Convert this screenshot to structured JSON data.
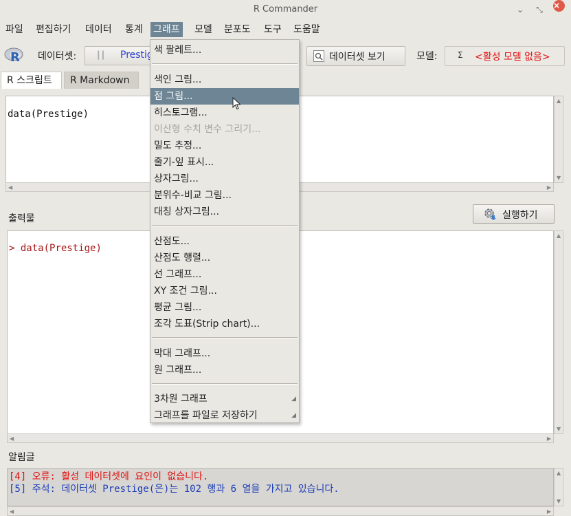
{
  "window": {
    "title": "R Commander"
  },
  "menubar": {
    "items": [
      "파일",
      "편집하기",
      "데이터",
      "통계",
      "그래프",
      "모델",
      "분포도",
      "도구",
      "도움말"
    ],
    "active": "그래프"
  },
  "toolbar": {
    "dataset_label": "데이터셋:",
    "dataset_value": "Prestige",
    "view_dataset_label": "데이터셋 보기",
    "model_label": "모델:",
    "model_symbol": "Σ",
    "model_value": "<활성 모델 없음>"
  },
  "tabs": [
    "R 스크립트",
    "R Markdown"
  ],
  "script": {
    "text": "data(Prestige)"
  },
  "output": {
    "label": "출력물",
    "run_label": "실행하기",
    "prompt": ">",
    "line": "data(Prestige)"
  },
  "messages": {
    "label": "알림글",
    "lines": [
      "[4] 오류: 활성 데이터셋에 요인이 없습니다.",
      "[5] 주석: 데이터셋 Prestige(은)는 102 행과 6 열을 가지고 있습니다."
    ],
    "colors": [
      "#e01010",
      "#1a3db8"
    ]
  },
  "graph_menu": {
    "items": [
      "색 팔레트...",
      "색인 그림...",
      "점 그림...",
      "히스토그램...",
      "이산형 수치 변수 그리기...",
      "밀도 추정...",
      "줄기-잎 표시...",
      "상자그림...",
      "분위수-비교 그림...",
      "대칭 상자그림...",
      "산점도...",
      "산점도 행렬...",
      "선 그래프...",
      "XY 조건 그림...",
      "평균 그림...",
      "조각 도표(Strip chart)...",
      "막대 그래프...",
      "원 그래프...",
      "3차원 그래프",
      "그래프를 파일로 저장하기"
    ],
    "highlighted": "점 그림...",
    "disabled": [
      "이산형 수치 변수 그리기..."
    ]
  },
  "colors": {
    "highlight": "#6d8595",
    "error": "#e01010",
    "note": "#1a3db8",
    "output": "#a31515"
  }
}
